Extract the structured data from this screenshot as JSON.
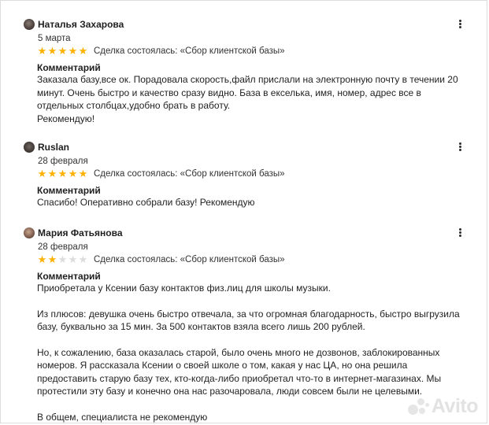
{
  "reviews": [
    {
      "author": "Наталья Захарова",
      "date": "5 марта",
      "rating": 5,
      "deal": "Сделка состоялась: «Сбор клиентской базы»",
      "comment_title": "Комментарий",
      "paragraphs": [
        "Заказала базу,все ок. Порадовала скорость,файл прислали на электронную почту в течении 20 минут. Очень быстро и качество сразу видно. База в екселька, имя, номер, адрес все в отдельных столбцах,удобно брать в работу.\nРекомендую!"
      ]
    },
    {
      "author": "Ruslan",
      "date": "28 февраля",
      "rating": 5,
      "deal": "Сделка состоялась: «Сбор клиентской базы»",
      "comment_title": "Комментарий",
      "paragraphs": [
        "Спасибо! Оперативно собрали базу! Рекомендую"
      ]
    },
    {
      "author": "Мария Фатьянова",
      "date": "28 февраля",
      "rating": 2,
      "deal": "Сделка состоялась: «Сбор клиентской базы»",
      "comment_title": "Комментарий",
      "paragraphs": [
        "Приобретала у Ксении базу контактов физ.лиц для школы музыки.",
        "Из плюсов: девушка очень быстро отвечала, за что огромная благодарность, быстро выгрузила базу, буквально за 15 мин. За 500 контактов взяла всего лишь 200 рублей.",
        "Но, к сожалению, база оказалась старой, было очень много не дозвонов, заблокированных номеров. Я рассказала Ксении о своей школе о том, какая у нас ЦА, но она решила предоставить старую базу тех, кто-когда-либо приобретал что-то в интернет-магазинах. Мы протестили эту базу и конечно она нас разочаровала, люди совсем были не целевыми.",
        "В общем, специалиста не рекомендую"
      ]
    }
  ],
  "watermark": "Avito",
  "colors": {
    "star_on": "#ffb100",
    "star_off": "#dcdcdc"
  }
}
